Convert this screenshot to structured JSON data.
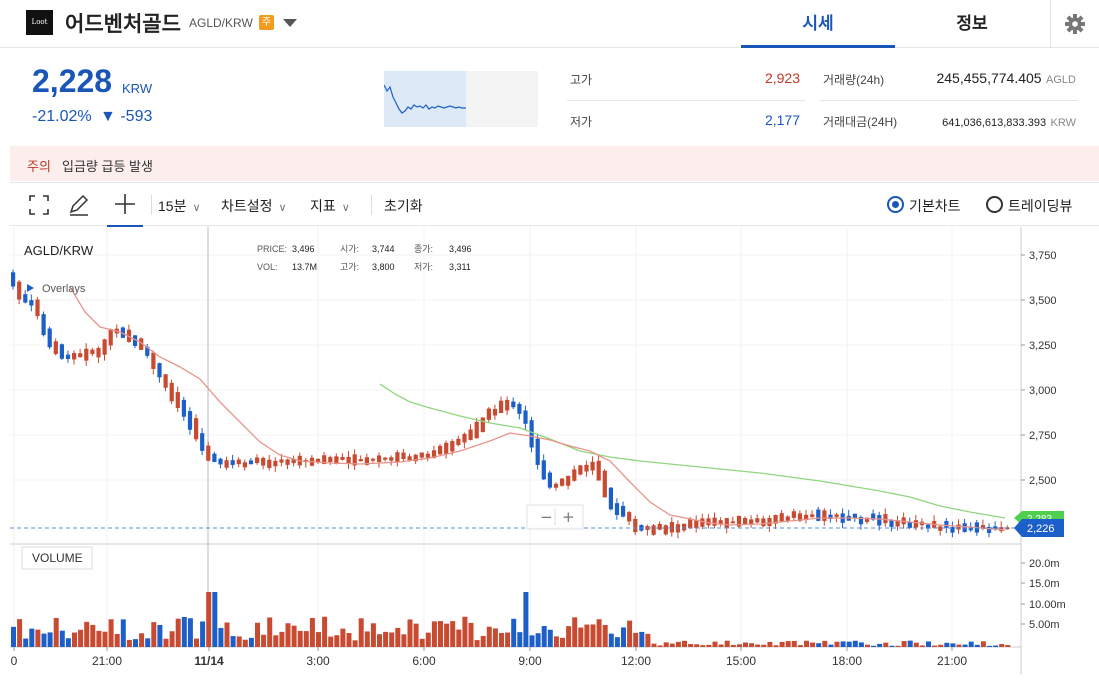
{
  "header": {
    "logo_text": "Loot",
    "coin_name": "어드벤처골드",
    "pair": "AGLD/KRW",
    "badge": "주",
    "tabs": [
      "시세",
      "정보"
    ]
  },
  "summary": {
    "price": "2,228",
    "price_unit": "KRW",
    "change_percent": "-21.02%",
    "change_arrow": "▼",
    "change_amount": "-593",
    "high_label": "고가",
    "high_value": "2,923",
    "low_label": "저가",
    "low_value": "2,177",
    "volume_label": "거래량(24h)",
    "volume_value": "245,455,774.405",
    "volume_unit": "AGLD",
    "amount_label": "거래대금(24H)",
    "amount_value": "641,036,613,833.393",
    "amount_unit": "KRW"
  },
  "alert": {
    "tag": "주의",
    "text": "입금량 급등 발생"
  },
  "toolbar": {
    "interval": "15분",
    "chart_settings": "차트설정",
    "indicators": "지표",
    "reset": "초기화",
    "basic_chart": "기본차트",
    "tradingview": "트레이딩뷰"
  },
  "chart": {
    "pair_label": "AGLD/KRW",
    "overlays_label": "Overlays",
    "legend": {
      "price_label": "PRICE:",
      "price": "3,496",
      "open_label": "시가:",
      "open": "3,744",
      "close_label": "종가:",
      "close": "3,496",
      "vol_label": "VOL:",
      "vol": "13.7M",
      "high_label": "고가:",
      "high": "3,800",
      "low_label": "저가:",
      "low": "3,311"
    },
    "volume_label": "VOLUME",
    "zoom_out": "−",
    "zoom_in": "+",
    "last_price_tag": "2,226",
    "ma_tag": "2,283",
    "colors": {
      "up": "#c84a31",
      "down": "#1d5fc8",
      "ma_short": "#e8948a",
      "ma_long": "#8fd67f"
    }
  },
  "chart_data": {
    "type": "candlestick",
    "y_ticks": [
      "3,750",
      "3,500",
      "3,250",
      "3,000",
      "2,750",
      "2,500"
    ],
    "volume_ticks": [
      "20.0m",
      "15.0m",
      "10.00m",
      "5.00m"
    ],
    "time_ticks": [
      "0",
      "21:00",
      "11/14",
      "3:00",
      "6:00",
      "9:00",
      "12:00",
      "15:00",
      "18:00",
      "21:00"
    ],
    "ylim": [
      2200,
      3900
    ]
  }
}
